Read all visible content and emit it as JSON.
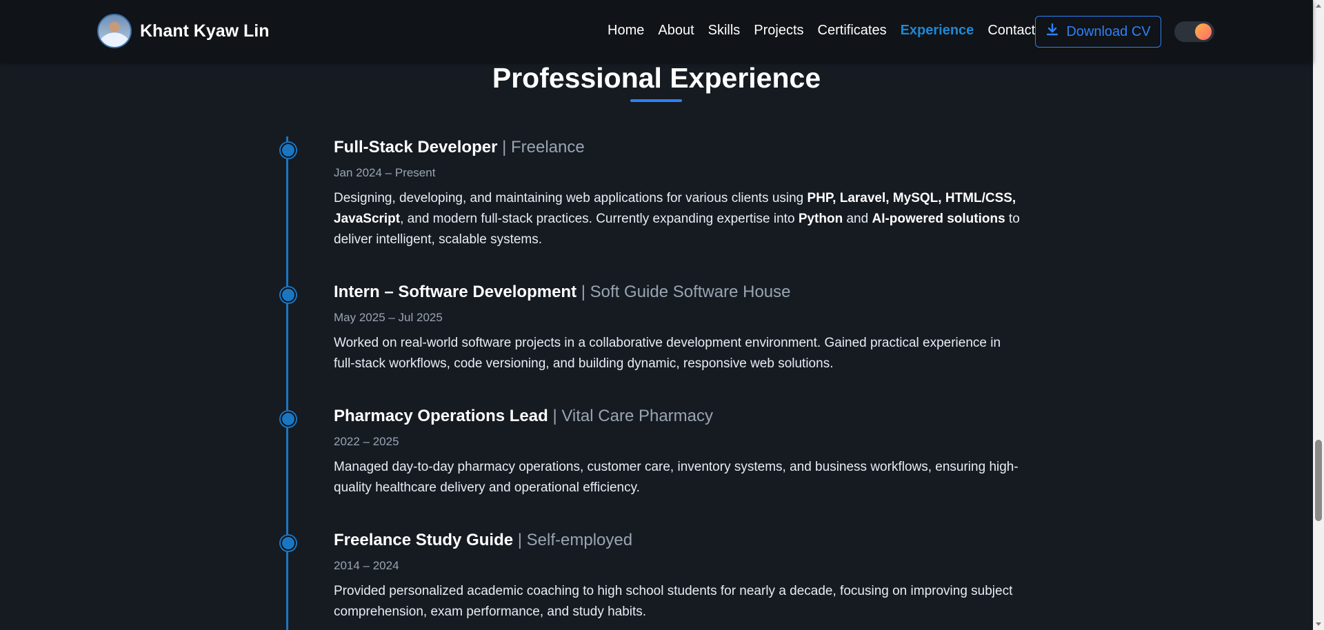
{
  "brand": {
    "name": "Khant Kyaw Lin"
  },
  "nav": {
    "links": [
      {
        "label": "Home",
        "active": false
      },
      {
        "label": "About",
        "active": false
      },
      {
        "label": "Skills",
        "active": false
      },
      {
        "label": "Projects",
        "active": false
      },
      {
        "label": "Certificates",
        "active": false
      },
      {
        "label": "Experience",
        "active": true
      },
      {
        "label": "Contact",
        "active": false
      }
    ],
    "cv_label": "Download CV",
    "theme_toggle_icon": "theme-toggle-icon"
  },
  "section": {
    "title": "Professional Experience"
  },
  "experience": [
    {
      "role": "Full-Stack Developer",
      "separator": "|",
      "org": "Freelance",
      "date": "Jan 2024 – Present",
      "desc": [
        {
          "t": "Designing, developing, and maintaining web applications for various clients using "
        },
        {
          "t": "PHP, Laravel, MySQL, HTML/CSS, JavaScript",
          "b": true
        },
        {
          "t": ", and modern full-stack practices. Currently expanding expertise into "
        },
        {
          "t": "Python",
          "b": true
        },
        {
          "t": " and "
        },
        {
          "t": "AI-powered solutions",
          "b": true
        },
        {
          "t": " to deliver intelligent, scalable systems."
        }
      ]
    },
    {
      "role": "Intern – Software Development",
      "separator": "|",
      "org": "Soft Guide Software House",
      "date": "May 2025 – Jul 2025",
      "desc": [
        {
          "t": "Worked on real-world software projects in a collaborative development environment. Gained practical experience in full-stack workflows, code versioning, and building dynamic, responsive web solutions."
        }
      ]
    },
    {
      "role": "Pharmacy Operations Lead",
      "separator": "|",
      "org": "Vital Care Pharmacy",
      "date": "2022 – 2025",
      "desc": [
        {
          "t": "Managed day-to-day pharmacy operations, customer care, inventory systems, and business workflows, ensuring high-quality healthcare delivery and operational efficiency."
        }
      ]
    },
    {
      "role": "Freelance Study Guide",
      "separator": "|",
      "org": "Self-employed",
      "date": "2014 – 2024",
      "desc": [
        {
          "t": "Provided personalized academic coaching to high school students for nearly a decade, focusing on improving subject comprehension, exam performance, and study habits."
        }
      ]
    }
  ],
  "colors": {
    "accent": "#1b76c2",
    "link_active": "#1e88d4",
    "button": "#2f81f7",
    "background": "#161b22",
    "navbar": "#101317"
  }
}
